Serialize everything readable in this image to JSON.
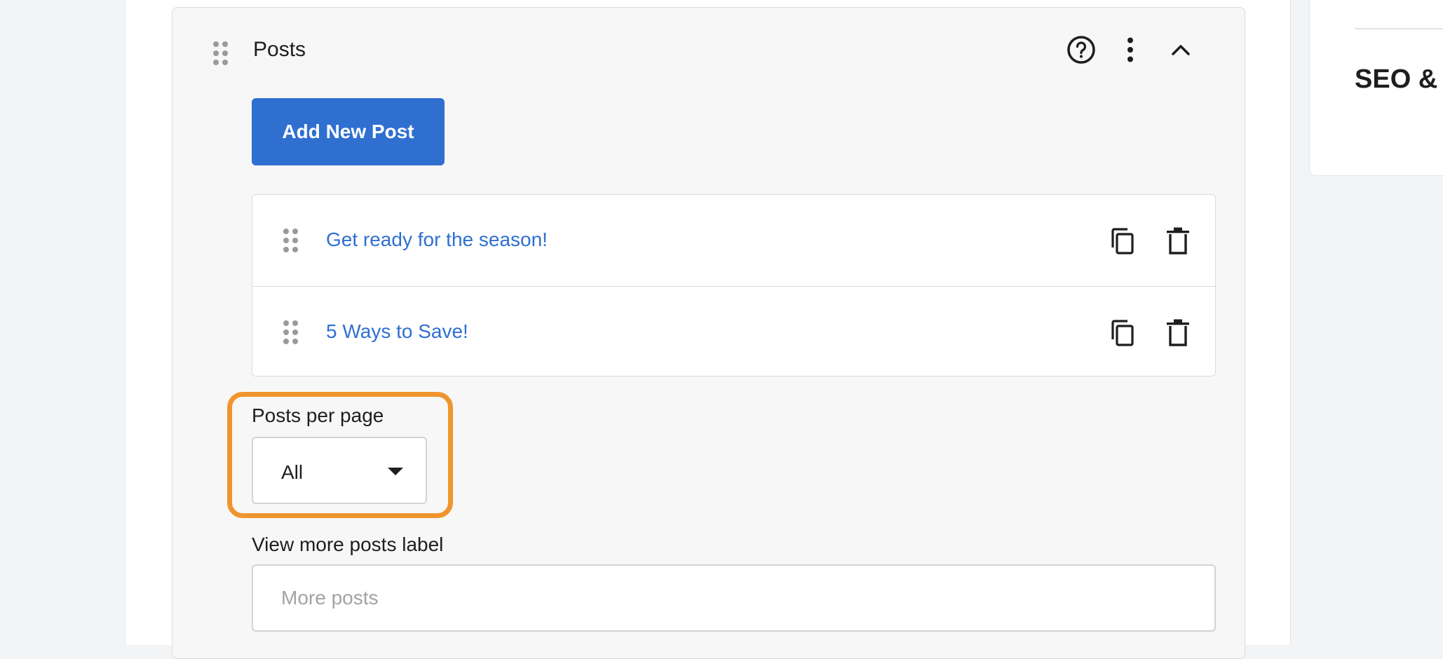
{
  "block": {
    "title": "Posts",
    "icons": {
      "help": "help-circle-icon",
      "more": "more-vertical-icon",
      "collapse": "chevron-up-icon"
    }
  },
  "add_button": {
    "label": "Add New Post"
  },
  "posts": [
    {
      "title": "Get ready for the season!"
    },
    {
      "title": "5 Ways to Save!"
    }
  ],
  "posts_per_page": {
    "label": "Posts per page",
    "value": "All"
  },
  "view_more": {
    "label": "View more posts label",
    "placeholder": "More posts",
    "value": ""
  },
  "side_panel": {
    "title": "SEO &"
  },
  "colors": {
    "accent": "#2f6fd0",
    "highlight": "#f0952d",
    "link": "#2f6fd0"
  }
}
